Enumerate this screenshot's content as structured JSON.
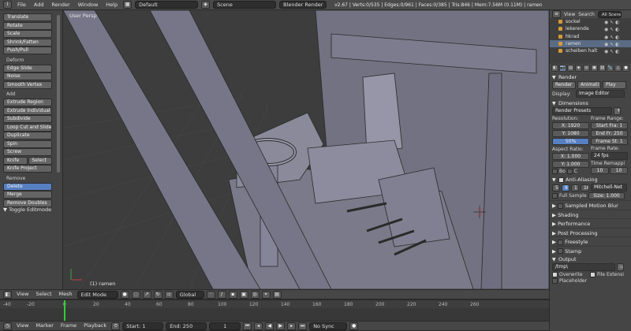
{
  "topbar": {
    "menus": [
      "File",
      "Add",
      "Render",
      "Window",
      "Help"
    ],
    "layout": "Default",
    "scene": "Scene",
    "engine": "Blender Render",
    "stats": "v2.67 | Verts:0/535 | Edges:0/961 | Faces:0/385 | Tris:846 | Mem:7.56M (0.11M) | ramen"
  },
  "toolshelf": {
    "transform": [
      "Translate",
      "Rotate",
      "Scale",
      "Shrink/Fatten",
      "Push/Pull"
    ],
    "deform_label": "Deform",
    "deform": [
      "Edge Slide",
      "Noise",
      "Smooth Vertex"
    ],
    "add_label": "Add",
    "add": [
      "Extrude Region",
      "Extrude Individual",
      "Subdivide",
      "Loop Cut and Slide",
      "Duplicate",
      "Spin",
      "Screw"
    ],
    "knife": "Knife",
    "select": "Select",
    "knife_project": "Knife Project",
    "remove_label": "Remove",
    "remove_selected": "Delete",
    "remove": [
      "Merge",
      "Remove Doubles"
    ],
    "toggle": "Toggle Editmode"
  },
  "viewport": {
    "label": "User Persp",
    "object": "(1) ramen"
  },
  "vpheader": {
    "view": "View",
    "select": "Select",
    "mesh": "Mesh",
    "mode": "Edit Mode",
    "orientation": "Global"
  },
  "timeline": {
    "ticks": [
      "-40",
      "-20",
      "0",
      "20",
      "40",
      "60",
      "80",
      "100",
      "120",
      "140",
      "160",
      "180",
      "200",
      "220",
      "240",
      "260"
    ],
    "view": "View",
    "marker": "Marker",
    "frame": "Frame",
    "playback": "Playback",
    "start": "Start: 1",
    "end": "End: 250",
    "current": "1",
    "sync": "No Sync"
  },
  "outliner": {
    "view": "View",
    "search": "Search",
    "scene_select": "All Scenes",
    "rows": [
      "sockel",
      "lekerende",
      "hkrad",
      "ramen",
      "scheiben halt"
    ]
  },
  "properties": {
    "render_panel": "Render",
    "render_btn": "Render",
    "animation_btn": "Animati",
    "play_btn": "Play",
    "display_label": "Display:",
    "display_value": "Image Editor",
    "dimensions_panel": "Dimensions",
    "presets": "Render Presets",
    "resolution_label": "Resolution:",
    "res_x": "X: 1920",
    "res_y": "Y: 1080",
    "res_pct": "50%",
    "frame_range_label": "Frame Range:",
    "start_frame": "Start Fra: 1",
    "end_frame": "End Fr: 250",
    "frame_step": "Frame St: 1",
    "aspect_label": "Aspect Ratio:",
    "aspect_x": "X: 1.000",
    "aspect_y": "Y: 1.000",
    "border": "Bo",
    "crop": "C",
    "frame_rate_label": "Frame Rate:",
    "fps": "24 fps",
    "time_remap_label": "Time Remappi",
    "remap_old": "10",
    "remap_new": "10",
    "aa_panel": "Anti-Aliasing",
    "aa_samples": [
      "5",
      "8",
      "11",
      "16"
    ],
    "aa_filter": "Mitchell-Net",
    "full_sample": "Full Sample",
    "aa_size": "Size: 1.000",
    "collapsed": [
      "Sampled Motion Blur",
      "Shading",
      "Performance",
      "Post Processing",
      "Freestyle",
      "Stamp"
    ],
    "output_panel": "Output",
    "output_path": "/tmp\\",
    "overwrite": "Overwrite",
    "file_ext": "File Extensi",
    "placeholders": "Placeholder"
  }
}
